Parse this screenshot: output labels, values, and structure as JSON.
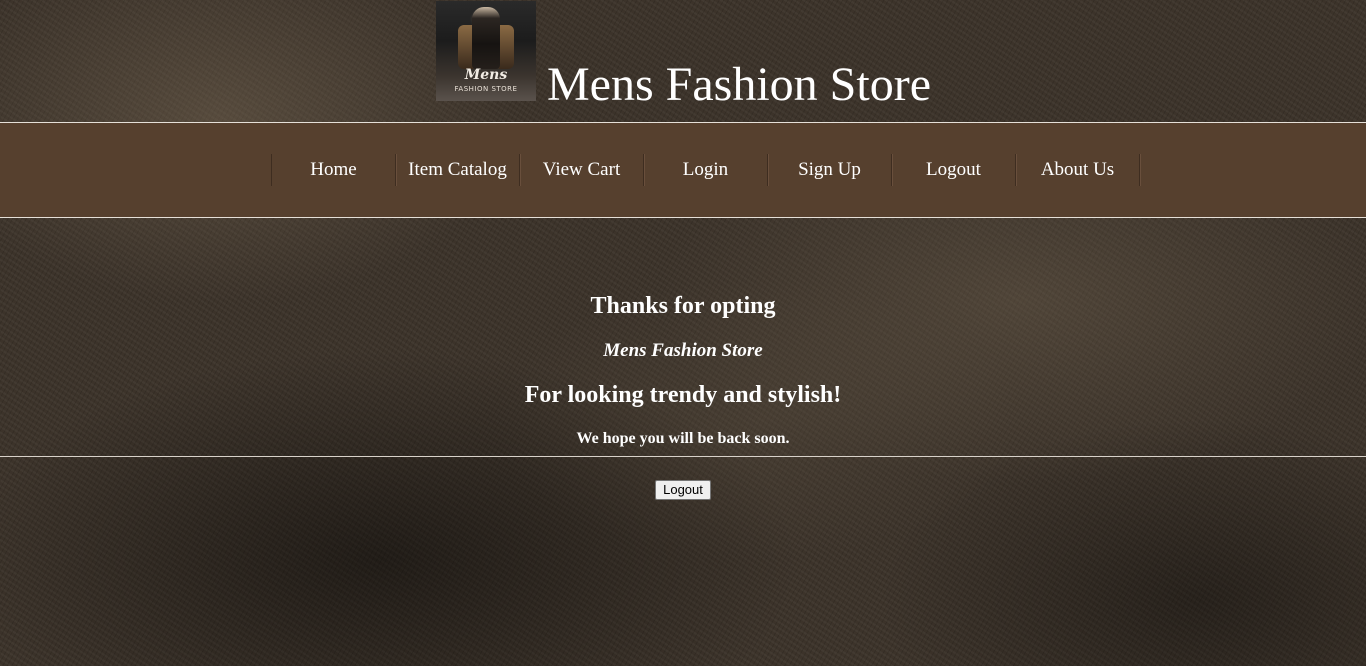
{
  "header": {
    "logo": {
      "script_text": "Mens",
      "sub_text": "FASHION STORE"
    },
    "title": "Mens Fashion Store"
  },
  "nav": {
    "items": [
      {
        "label": "Home"
      },
      {
        "label": "Item Catalog"
      },
      {
        "label": "View Cart"
      },
      {
        "label": "Login"
      },
      {
        "label": "Sign Up"
      },
      {
        "label": "Logout"
      },
      {
        "label": "About Us"
      }
    ]
  },
  "main": {
    "thanks": "Thanks for opting",
    "store_name": "Mens Fashion Store",
    "tagline": "For looking trendy and stylish!",
    "farewell": "We hope you will be back soon.",
    "logout_button": "Logout"
  },
  "colors": {
    "nav_background": "#56402e",
    "text": "#ffffff"
  }
}
